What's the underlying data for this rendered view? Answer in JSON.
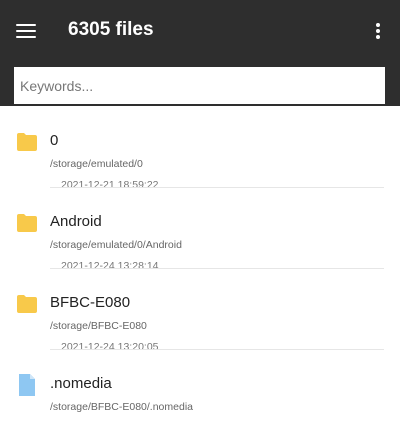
{
  "header": {
    "title": "6305 files",
    "menu_icon": "hamburger-menu-icon",
    "more_icon": "more-vert-icon"
  },
  "search": {
    "placeholder": "Keywords...",
    "value": ""
  },
  "colors": {
    "toolbar": "#2e2e2e",
    "folder": "#f8c94a",
    "file": "#8ec7f2"
  },
  "files": [
    {
      "name": "0",
      "path": "/storage/emulated/0",
      "date": "2021-12-21 18:59:22",
      "icon": "folder-icon"
    },
    {
      "name": "Android",
      "path": "/storage/emulated/0/Android",
      "date": "2021-12-24 13:28:14",
      "icon": "folder-icon"
    },
    {
      "name": "BFBC-E080",
      "path": "/storage/BFBC-E080",
      "date": "2021-12-24 13:20:05",
      "icon": "folder-icon"
    },
    {
      "name": ".nomedia",
      "path": "/storage/BFBC-E080/.nomedia",
      "date": "",
      "icon": "file-icon"
    }
  ]
}
